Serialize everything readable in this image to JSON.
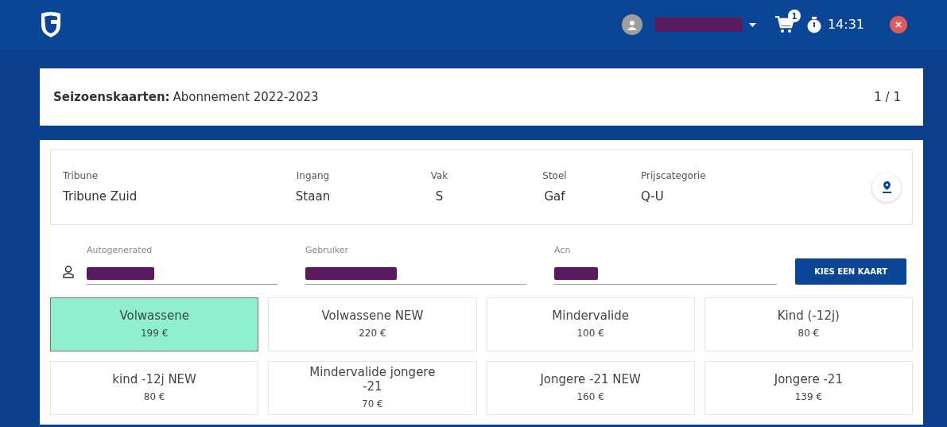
{
  "header": {
    "cart_count": "1",
    "timer": "14:31"
  },
  "title_card": {
    "label": "Seizoenskaarten:",
    "value": "Abonnement 2022-2023",
    "page": "1 / 1"
  },
  "seat": [
    {
      "label": "Tribune",
      "value": "Tribune Zuid"
    },
    {
      "label": "Ingang",
      "value": "Staan"
    },
    {
      "label": "Vak",
      "value": "S"
    },
    {
      "label": "Stoel",
      "value": "Gaf"
    },
    {
      "label": "Prijscategorie",
      "value": "Q-U"
    }
  ],
  "fields": [
    {
      "label": "Autogenerated",
      "redacted": true
    },
    {
      "label": "Gebruiker",
      "redacted": true
    },
    {
      "label": "Acn",
      "redacted": true
    }
  ],
  "choose_button": "KIES EEN KAART",
  "tickets": [
    {
      "name": "Volwassene",
      "price": "199 €",
      "selected": true
    },
    {
      "name": "Volwassene NEW",
      "price": "220 €",
      "selected": false
    },
    {
      "name": "Mindervalide",
      "price": "100 €",
      "selected": false
    },
    {
      "name": "Kind (-12j)",
      "price": "80 €",
      "selected": false
    },
    {
      "name": "kind -12j NEW",
      "price": "80 €",
      "selected": false
    },
    {
      "name": "Mindervalide jongere -21",
      "price": "70 €",
      "selected": false
    },
    {
      "name": "Jongere -21 NEW",
      "price": "160 €",
      "selected": false
    },
    {
      "name": "Jongere -21",
      "price": "139 €",
      "selected": false
    }
  ]
}
